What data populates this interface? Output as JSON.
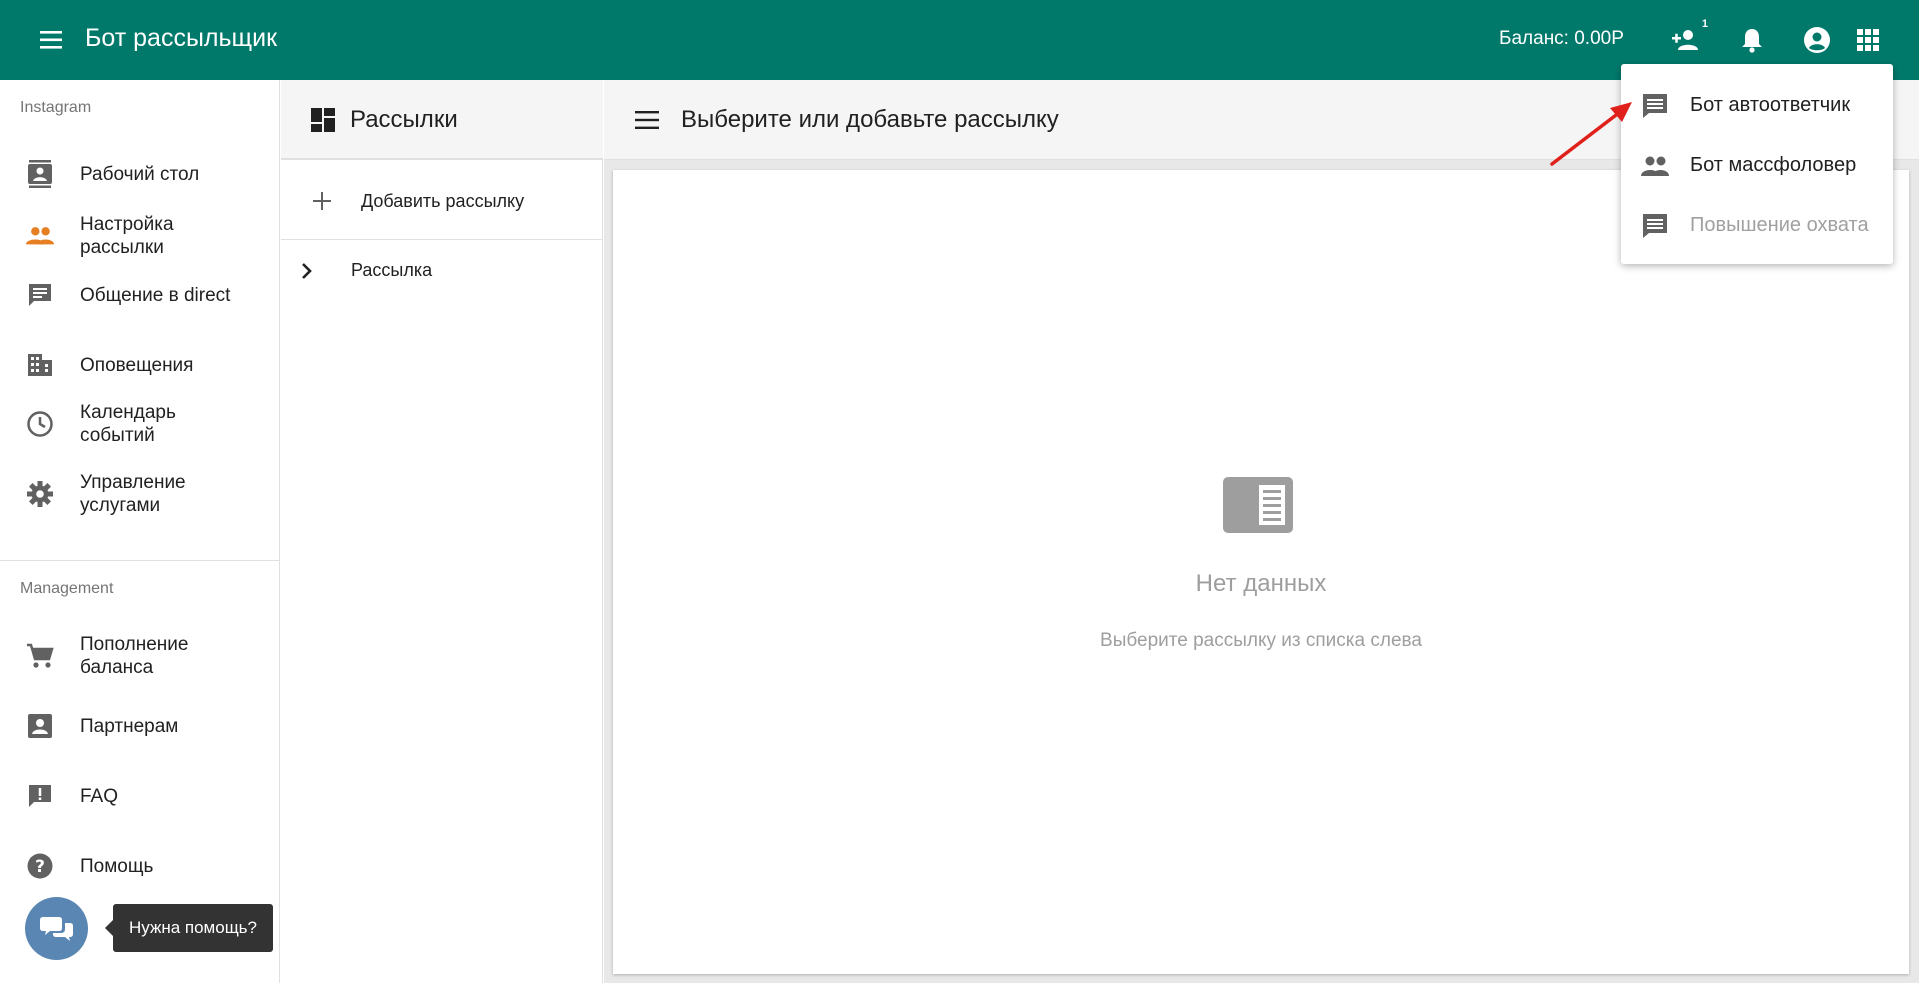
{
  "appbar": {
    "title": "Бот рассыльщик",
    "balance": "Баланс: 0.00Р",
    "friends_badge": "1",
    "icons": [
      "menu-icon",
      "person-add-icon",
      "bell-icon",
      "account-circle-icon",
      "apps-grid-icon"
    ]
  },
  "sidebar": {
    "section_instagram": "Instagram",
    "section_management": "Management",
    "items": [
      {
        "label": "Рабочий стол",
        "icon": "contacts-icon"
      },
      {
        "label": "Настройка рассылки",
        "icon": "people-icon",
        "active": true
      },
      {
        "label": "Общение в direct",
        "icon": "chat-icon"
      },
      {
        "label": "Оповещения",
        "icon": "building-icon"
      },
      {
        "label": "Календарь событий",
        "icon": "clock-icon"
      },
      {
        "label": "Управление услугами",
        "icon": "gear-icon"
      },
      {
        "label": "Пополнение баланса",
        "icon": "cart-icon"
      },
      {
        "label": "Партнерам",
        "icon": "account-box-icon"
      },
      {
        "label": "FAQ",
        "icon": "feedback-icon"
      },
      {
        "label": "Помощь",
        "icon": "help-icon"
      }
    ],
    "active_color": "#e67e22"
  },
  "midpanel": {
    "title": "Рассылки",
    "add_label": "Добавить рассылку",
    "items": [
      {
        "label": "Рассылка"
      }
    ]
  },
  "main": {
    "title": "Выберите или добавьте рассылку",
    "empty_title": "Нет данных",
    "empty_subtitle": "Выберите рассылку из списка слева"
  },
  "dropdown": {
    "items": [
      {
        "label": "Бот автоответчик",
        "icon": "message-icon",
        "disabled": false
      },
      {
        "label": "Бот массфоловер",
        "icon": "people-icon",
        "disabled": false
      },
      {
        "label": "Повышение охвата",
        "icon": "message-icon",
        "disabled": true
      }
    ]
  },
  "chat": {
    "tooltip": "Нужна помощь?"
  },
  "colors": {
    "appbar": "#00796b",
    "accent": "#e67e22",
    "chat": "#5a86b4",
    "arrow": "#e0201b"
  }
}
